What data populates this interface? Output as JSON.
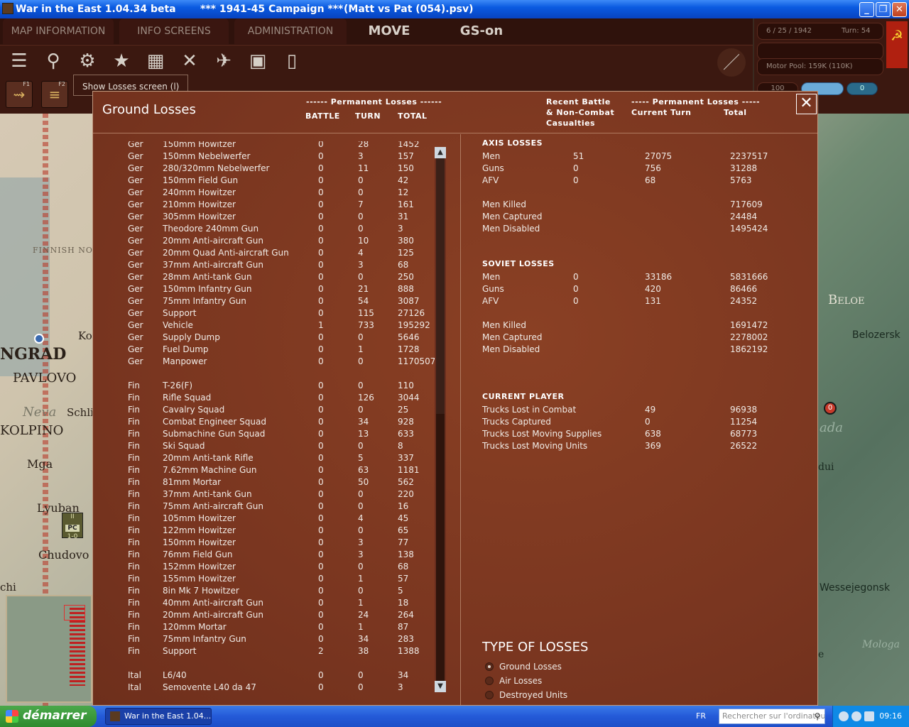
{
  "window": {
    "title_app": "War in the East 1.04.34 beta",
    "title_mid": "***    1941-45 Campaign    ***",
    "title_file": "(Matt vs Pat (054).psv)",
    "btn_min": "_",
    "btn_max": "❐",
    "btn_close": "✕"
  },
  "menu": {
    "map_information": "MAP INFORMATION",
    "info_screens": "INFO SCREENS",
    "administration": "ADMINISTRATION",
    "move": "MOVE",
    "gs_on": "GS-on"
  },
  "toolbar": {
    "tooltip": "Show Losses screen (l)",
    "fkeys": [
      "F1",
      "F2"
    ]
  },
  "side": {
    "date": "6 / 25 / 1942",
    "turn": "Turn: 54",
    "motor_pool": "Motor Pool:  159K (110K)",
    "pill_left": "100",
    "pill_right": "0"
  },
  "map_labels": {
    "finnish": "FINNISH NO",
    "ngrad": "NGRAD",
    "pavlovo": "PAVLOVO",
    "neva": "Neva",
    "schli": "Schli",
    "kolpino": "KOLPINO",
    "mga": "Mga",
    "lyuban": "Lyuban",
    "chudovo": "Chudovo",
    "chi": "chi",
    "ko": "Ko",
    "beloe": "Beloe",
    "belozersk": "Belozersk",
    "ada": "ada",
    "dui": "dui",
    "wessejegonsk": "Wessejegonsk",
    "mologa": "Mologa",
    "e": "e",
    "chip_top": "II",
    "chip_pc": "PC",
    "chip_bottom": "1-0",
    "marker": "0"
  },
  "dialog": {
    "title": "Ground Losses",
    "close_glyph": "✕",
    "left_header_group": "------ Permanent Losses ------",
    "col_battle": "BATTLE",
    "col_turn": "TURN",
    "col_total": "TOTAL",
    "right_recent_1": "Recent Battle",
    "right_recent_2": "& Non-Combat",
    "right_recent_3": "Casualties",
    "right_perm_group": "----- Permanent Losses -----",
    "right_current_turn": "Current Turn",
    "right_total": "Total",
    "rows": [
      {
        "nat": "Ger",
        "name": "150mm Howitzer",
        "b": "0",
        "t": "28",
        "tot": "1452"
      },
      {
        "nat": "Ger",
        "name": "150mm Nebelwerfer",
        "b": "0",
        "t": "3",
        "tot": "157"
      },
      {
        "nat": "Ger",
        "name": "280/320mm Nebelwerfer",
        "b": "0",
        "t": "11",
        "tot": "150"
      },
      {
        "nat": "Ger",
        "name": "150mm Field Gun",
        "b": "0",
        "t": "0",
        "tot": "42"
      },
      {
        "nat": "Ger",
        "name": "240mm Howitzer",
        "b": "0",
        "t": "0",
        "tot": "12"
      },
      {
        "nat": "Ger",
        "name": "210mm Howitzer",
        "b": "0",
        "t": "7",
        "tot": "161"
      },
      {
        "nat": "Ger",
        "name": "305mm Howitzer",
        "b": "0",
        "t": "0",
        "tot": "31"
      },
      {
        "nat": "Ger",
        "name": "Theodore 240mm Gun",
        "b": "0",
        "t": "0",
        "tot": "3"
      },
      {
        "nat": "Ger",
        "name": "20mm Anti-aircraft Gun",
        "b": "0",
        "t": "10",
        "tot": "380"
      },
      {
        "nat": "Ger",
        "name": "20mm Quad Anti-aircraft Gun",
        "b": "0",
        "t": "4",
        "tot": "125"
      },
      {
        "nat": "Ger",
        "name": "37mm Anti-aircraft Gun",
        "b": "0",
        "t": "3",
        "tot": "68"
      },
      {
        "nat": "Ger",
        "name": "28mm Anti-tank Gun",
        "b": "0",
        "t": "0",
        "tot": "250"
      },
      {
        "nat": "Ger",
        "name": "150mm Infantry Gun",
        "b": "0",
        "t": "21",
        "tot": "888"
      },
      {
        "nat": "Ger",
        "name": "75mm Infantry Gun",
        "b": "0",
        "t": "54",
        "tot": "3087"
      },
      {
        "nat": "Ger",
        "name": "Support",
        "b": "0",
        "t": "115",
        "tot": "27126"
      },
      {
        "nat": "Ger",
        "name": "Vehicle",
        "b": "1",
        "t": "733",
        "tot": "195292"
      },
      {
        "nat": "Ger",
        "name": "Supply Dump",
        "b": "0",
        "t": "0",
        "tot": "5646"
      },
      {
        "nat": "Ger",
        "name": "Fuel Dump",
        "b": "0",
        "t": "1",
        "tot": "1728"
      },
      {
        "nat": "Ger",
        "name": "Manpower",
        "b": "0",
        "t": "0",
        "tot": "1170507"
      },
      {
        "nat": "",
        "name": "",
        "b": "",
        "t": "",
        "tot": ""
      },
      {
        "nat": "Fin",
        "name": "T-26(F)",
        "b": "0",
        "t": "0",
        "tot": "110"
      },
      {
        "nat": "Fin",
        "name": "Rifle Squad",
        "b": "0",
        "t": "126",
        "tot": "3044"
      },
      {
        "nat": "Fin",
        "name": "Cavalry Squad",
        "b": "0",
        "t": "0",
        "tot": "25"
      },
      {
        "nat": "Fin",
        "name": "Combat Engineer Squad",
        "b": "0",
        "t": "34",
        "tot": "928"
      },
      {
        "nat": "Fin",
        "name": "Submachine Gun Squad",
        "b": "0",
        "t": "13",
        "tot": "633"
      },
      {
        "nat": "Fin",
        "name": "Ski Squad",
        "b": "0",
        "t": "0",
        "tot": "8"
      },
      {
        "nat": "Fin",
        "name": "20mm Anti-tank Rifle",
        "b": "0",
        "t": "5",
        "tot": "337"
      },
      {
        "nat": "Fin",
        "name": "7.62mm Machine Gun",
        "b": "0",
        "t": "63",
        "tot": "1181"
      },
      {
        "nat": "Fin",
        "name": "81mm Mortar",
        "b": "0",
        "t": "50",
        "tot": "562"
      },
      {
        "nat": "Fin",
        "name": "37mm Anti-tank Gun",
        "b": "0",
        "t": "0",
        "tot": "220"
      },
      {
        "nat": "Fin",
        "name": "75mm Anti-aircraft Gun",
        "b": "0",
        "t": "0",
        "tot": "16"
      },
      {
        "nat": "Fin",
        "name": "105mm Howitzer",
        "b": "0",
        "t": "4",
        "tot": "45"
      },
      {
        "nat": "Fin",
        "name": "122mm Howitzer",
        "b": "0",
        "t": "0",
        "tot": "65"
      },
      {
        "nat": "Fin",
        "name": "150mm Howitzer",
        "b": "0",
        "t": "3",
        "tot": "77"
      },
      {
        "nat": "Fin",
        "name": "76mm Field Gun",
        "b": "0",
        "t": "3",
        "tot": "138"
      },
      {
        "nat": "Fin",
        "name": "152mm Howitzer",
        "b": "0",
        "t": "0",
        "tot": "68"
      },
      {
        "nat": "Fin",
        "name": "155mm Howitzer",
        "b": "0",
        "t": "1",
        "tot": "57"
      },
      {
        "nat": "Fin",
        "name": "8in Mk 7 Howitzer",
        "b": "0",
        "t": "0",
        "tot": "5"
      },
      {
        "nat": "Fin",
        "name": "40mm Anti-aircraft Gun",
        "b": "0",
        "t": "1",
        "tot": "18"
      },
      {
        "nat": "Fin",
        "name": "20mm Anti-aircraft Gun",
        "b": "0",
        "t": "24",
        "tot": "264"
      },
      {
        "nat": "Fin",
        "name": "120mm Mortar",
        "b": "0",
        "t": "1",
        "tot": "87"
      },
      {
        "nat": "Fin",
        "name": "75mm Infantry Gun",
        "b": "0",
        "t": "34",
        "tot": "283"
      },
      {
        "nat": "Fin",
        "name": "Support",
        "b": "2",
        "t": "38",
        "tot": "1388"
      },
      {
        "nat": "",
        "name": "",
        "b": "",
        "t": "",
        "tot": ""
      },
      {
        "nat": "Ital",
        "name": "L6/40",
        "b": "0",
        "t": "0",
        "tot": "34"
      },
      {
        "nat": "Ital",
        "name": "Semovente L40 da 47",
        "b": "0",
        "t": "0",
        "tot": "3"
      }
    ],
    "scroll_up": "▲",
    "scroll_down": "▼",
    "axis": {
      "heading": "AXIS LOSSES",
      "rows": [
        {
          "label": "Men",
          "recent": "51",
          "turn": "27075",
          "total": "2237517"
        },
        {
          "label": "Guns",
          "recent": "0",
          "turn": "756",
          "total": "31288"
        },
        {
          "label": "AFV",
          "recent": "0",
          "turn": "68",
          "total": "5763"
        }
      ],
      "detail": [
        {
          "label": "Men Killed",
          "total": "717609"
        },
        {
          "label": "Men Captured",
          "total": "24484"
        },
        {
          "label": "Men Disabled",
          "total": "1495424"
        }
      ]
    },
    "soviet": {
      "heading": "SOVIET LOSSES",
      "rows": [
        {
          "label": "Men",
          "recent": "0",
          "turn": "33186",
          "total": "5831666"
        },
        {
          "label": "Guns",
          "recent": "0",
          "turn": "420",
          "total": "86466"
        },
        {
          "label": "AFV",
          "recent": "0",
          "turn": "131",
          "total": "24352"
        }
      ],
      "detail": [
        {
          "label": "Men Killed",
          "total": "1691472"
        },
        {
          "label": "Men Captured",
          "total": "2278002"
        },
        {
          "label": "Men Disabled",
          "total": "1862192"
        }
      ]
    },
    "player": {
      "heading": "CURRENT PLAYER",
      "rows": [
        {
          "label": "Trucks Lost in Combat",
          "turn": "49",
          "total": "96938"
        },
        {
          "label": "Trucks Captured",
          "turn": "0",
          "total": "11254"
        },
        {
          "label": "Trucks Lost Moving Supplies",
          "turn": "638",
          "total": "68773"
        },
        {
          "label": "Trucks Lost Moving Units",
          "turn": "369",
          "total": "26522"
        }
      ]
    },
    "type_title": "TYPE OF LOSSES",
    "types": [
      {
        "label": "Ground Losses",
        "selected": true
      },
      {
        "label": "Air Losses",
        "selected": false
      },
      {
        "label": "Destroyed Units",
        "selected": false
      }
    ]
  },
  "taskbar": {
    "start": "démarrer",
    "task": "War in the East 1.04....",
    "lang": "FR",
    "search_placeholder": "Rechercher sur l'ordinateur",
    "clock": "09:16"
  }
}
